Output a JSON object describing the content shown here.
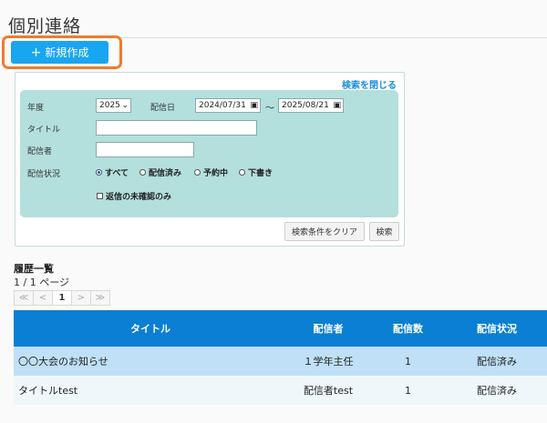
{
  "header": {
    "title": "個別連絡",
    "new_button_label": "新規作成"
  },
  "search": {
    "close_label": "検索を閉じる",
    "year_label": "年度",
    "year_value": "2025",
    "date_label": "配信日",
    "date_from": "2024/07/31",
    "date_sep": "〜",
    "date_to": "2025/08/21",
    "title_label": "タイトル",
    "title_value": "",
    "sender_label": "配信者",
    "sender_value": "",
    "status_label": "配信状況",
    "status_options": [
      "すべて",
      "配信済み",
      "予約中",
      "下書き"
    ],
    "status_selected": "すべて",
    "unconfirmed_label": "返信の未確認のみ",
    "clear_button": "検索条件をクリア",
    "search_button": "検索"
  },
  "history": {
    "title": "履歴一覧",
    "page_count": "1 / 1 ページ",
    "pager": {
      "first": "≪",
      "prev": "<",
      "current": "1",
      "next": ">",
      "last": "≫"
    },
    "columns": [
      "タイトル",
      "配信者",
      "配信数",
      "配信状況"
    ],
    "rows": [
      {
        "title": "〇〇大会のお知らせ",
        "sender": "１学年主任",
        "count": "1",
        "status": "配信済み"
      },
      {
        "title": "タイトルtest",
        "sender": "配信者test",
        "count": "1",
        "status": "配信済み"
      }
    ]
  },
  "colors": {
    "accent": "#18a6f0",
    "header_bg": "#0a7fd3",
    "search_bg": "#b3dfdd",
    "highlight": "#f07b2e"
  }
}
